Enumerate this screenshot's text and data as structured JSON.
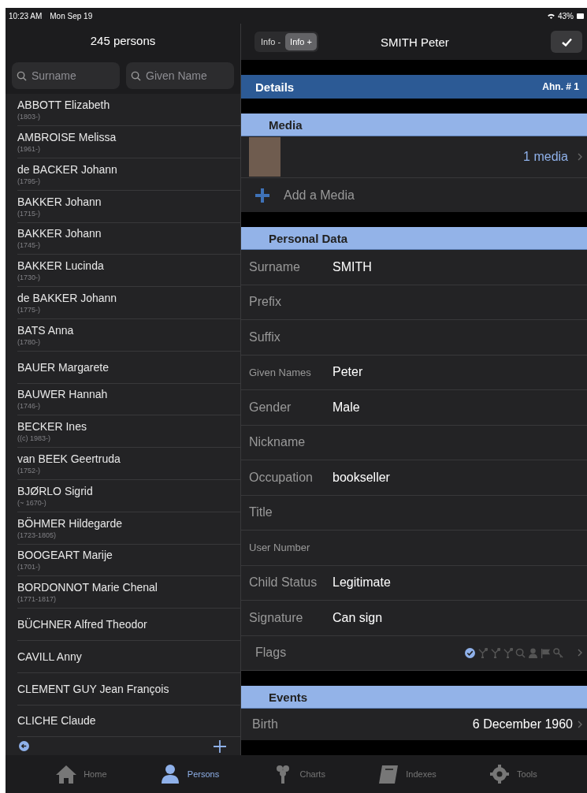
{
  "status_bar": {
    "time": "10:23 AM",
    "date": "Mon Sep 19",
    "battery": "43%"
  },
  "list_header": {
    "title": "245 persons"
  },
  "search": [
    {
      "placeholder": "Surname"
    },
    {
      "placeholder": "Given Name"
    }
  ],
  "persons": [
    {
      "name": "ABBOTT Elizabeth",
      "dates": "(1803-)"
    },
    {
      "name": "AMBROISE Melissa",
      "dates": "(1961-)"
    },
    {
      "name": "de BACKER Johann",
      "dates": "(1795-)"
    },
    {
      "name": "BAKKER Johann",
      "dates": "(1715-)"
    },
    {
      "name": "BAKKER Johann",
      "dates": "(1745-)"
    },
    {
      "name": "BAKKER Lucinda",
      "dates": "(1730-)"
    },
    {
      "name": "de BAKKER Johann",
      "dates": "(1775-)"
    },
    {
      "name": "BATS Anna",
      "dates": "(1780-)"
    },
    {
      "name": "BAUER Margarete"
    },
    {
      "name": "BAUWER Hannah",
      "dates": "(1746-)"
    },
    {
      "name": "BECKER Ines",
      "dates": "((c) 1983-)"
    },
    {
      "name": "van BEEK Geertruda",
      "dates": "(1752-)"
    },
    {
      "name": "BJØRLO Sigrid",
      "dates": "(~ 1670-)"
    },
    {
      "name": "BÖHMER Hildegarde",
      "dates": "(1723-1805)"
    },
    {
      "name": "BOOGEART Marije",
      "dates": "(1701-)"
    },
    {
      "name": "BORDONNOT Marie Chenal",
      "dates": "(1771-1817)"
    },
    {
      "name": "BÜCHNER Alfred Theodor"
    },
    {
      "name": "CAVILL Anny"
    },
    {
      "name": "CLEMENT GUY Jean François"
    },
    {
      "name": "CLICHE Claude"
    }
  ],
  "detail_header": {
    "segments": [
      {
        "label": "Info -",
        "selected": false
      },
      {
        "label": "Info +",
        "selected": true
      }
    ],
    "title": "SMITH Peter"
  },
  "details": {
    "title": "Details",
    "ahn": "Ahn. # 1"
  },
  "media": {
    "title": "Media",
    "count": "1 media",
    "add": "Add a Media"
  },
  "personal_data": {
    "title": "Personal Data",
    "rows": [
      {
        "kind": "field",
        "label": "Surname",
        "value": "SMITH"
      },
      {
        "kind": "field",
        "label": "Prefix"
      },
      {
        "kind": "field",
        "label": "Suffix"
      },
      {
        "kind": "field",
        "label": "Given Names",
        "value": "Peter",
        "small": true
      },
      {
        "kind": "field",
        "label": "Gender",
        "value": "Male"
      },
      {
        "kind": "field",
        "label": "Nickname"
      },
      {
        "kind": "field",
        "label": "Occupation",
        "value": "bookseller"
      },
      {
        "kind": "field",
        "label": "Title"
      },
      {
        "kind": "field",
        "label": "User Number",
        "small": true
      },
      {
        "kind": "field",
        "label": "Child Status",
        "value": "Legitimate"
      },
      {
        "kind": "field",
        "label": "Signature",
        "value": "Can sign"
      },
      {
        "kind": "flags",
        "label": "Flags",
        "flags": [
          {
            "on": true
          },
          {
            "on": false
          },
          {
            "on": false
          },
          {
            "on": false
          },
          {
            "on": false
          },
          {
            "on": false
          },
          {
            "on": false
          },
          {
            "on": false
          }
        ]
      }
    ]
  },
  "events": {
    "title": "Events",
    "rows": [
      {
        "label": "Birth",
        "value": "6 December 1960"
      }
    ]
  },
  "tab_bar": [
    {
      "label": "Home",
      "selected": false
    },
    {
      "label": "Persons",
      "selected": true
    },
    {
      "label": "Charts",
      "selected": false
    },
    {
      "label": "Indexes",
      "selected": false
    },
    {
      "label": "Tools",
      "selected": false
    }
  ]
}
